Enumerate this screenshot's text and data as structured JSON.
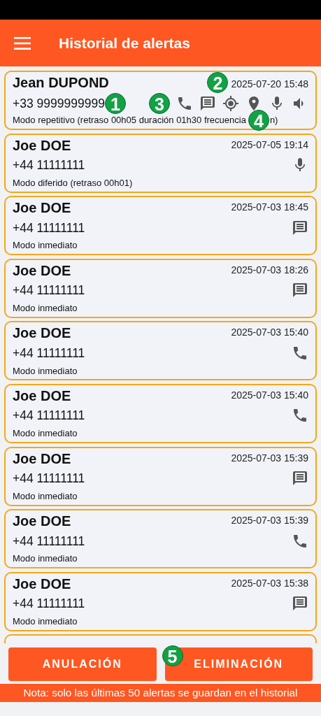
{
  "app_bar": {
    "title": "Historial de alertas"
  },
  "alerts": [
    {
      "name": "Jean DUPOND",
      "date": "2025-07-20 15:48",
      "phone": "+33 9999999999",
      "mode": "Modo repetitivo (retraso 00h05 duración 01h30 frecuencia",
      "mode_tail": "n)",
      "icons": [
        {
          "kind": "phone"
        },
        {
          "kind": "message"
        },
        {
          "kind": "gps"
        },
        {
          "kind": "pin"
        },
        {
          "kind": "mic"
        },
        {
          "kind": "speaker"
        }
      ],
      "callouts": {
        "phone": "1",
        "date": "2",
        "icons": "3",
        "mode": "4"
      }
    },
    {
      "name": "Joe DOE",
      "date": "2025-07-05 19:14",
      "phone": "+44 11111111",
      "mode": "Modo diferido (retraso 00h01)",
      "icons": [
        {
          "kind": "mic"
        }
      ]
    },
    {
      "name": "Joe DOE",
      "date": "2025-07-03 18:45",
      "phone": "+44 11111111",
      "mode": "Modo inmediato",
      "icons": [
        {
          "kind": "message"
        }
      ]
    },
    {
      "name": "Joe DOE",
      "date": "2025-07-03 18:26",
      "phone": "+44 11111111",
      "mode": "Modo inmediato",
      "icons": [
        {
          "kind": "message"
        }
      ]
    },
    {
      "name": "Joe DOE",
      "date": "2025-07-03 15:40",
      "phone": "+44 11111111",
      "mode": "Modo inmediato",
      "icons": [
        {
          "kind": "phone"
        }
      ]
    },
    {
      "name": "Joe DOE",
      "date": "2025-07-03 15:40",
      "phone": "+44 11111111",
      "mode": "Modo inmediato",
      "icons": [
        {
          "kind": "phone"
        }
      ]
    },
    {
      "name": "Joe DOE",
      "date": "2025-07-03 15:39",
      "phone": "+44 11111111",
      "mode": "Modo inmediato",
      "icons": [
        {
          "kind": "message"
        }
      ]
    },
    {
      "name": "Joe DOE",
      "date": "2025-07-03 15:39",
      "phone": "+44 11111111",
      "mode": "Modo inmediato",
      "icons": [
        {
          "kind": "phone"
        }
      ]
    },
    {
      "name": "Joe DOE",
      "date": "2025-07-03 15:38",
      "phone": "+44 11111111",
      "mode": "Modo inmediato",
      "icons": [
        {
          "kind": "message"
        }
      ]
    }
  ],
  "buttons": [
    {
      "label": "ANULACIÓN"
    },
    {
      "label": "ELIMINACIÓN",
      "callout": "5"
    }
  ],
  "note": "Nota: solo las últimas 50 alertas se guardan en el historial"
}
